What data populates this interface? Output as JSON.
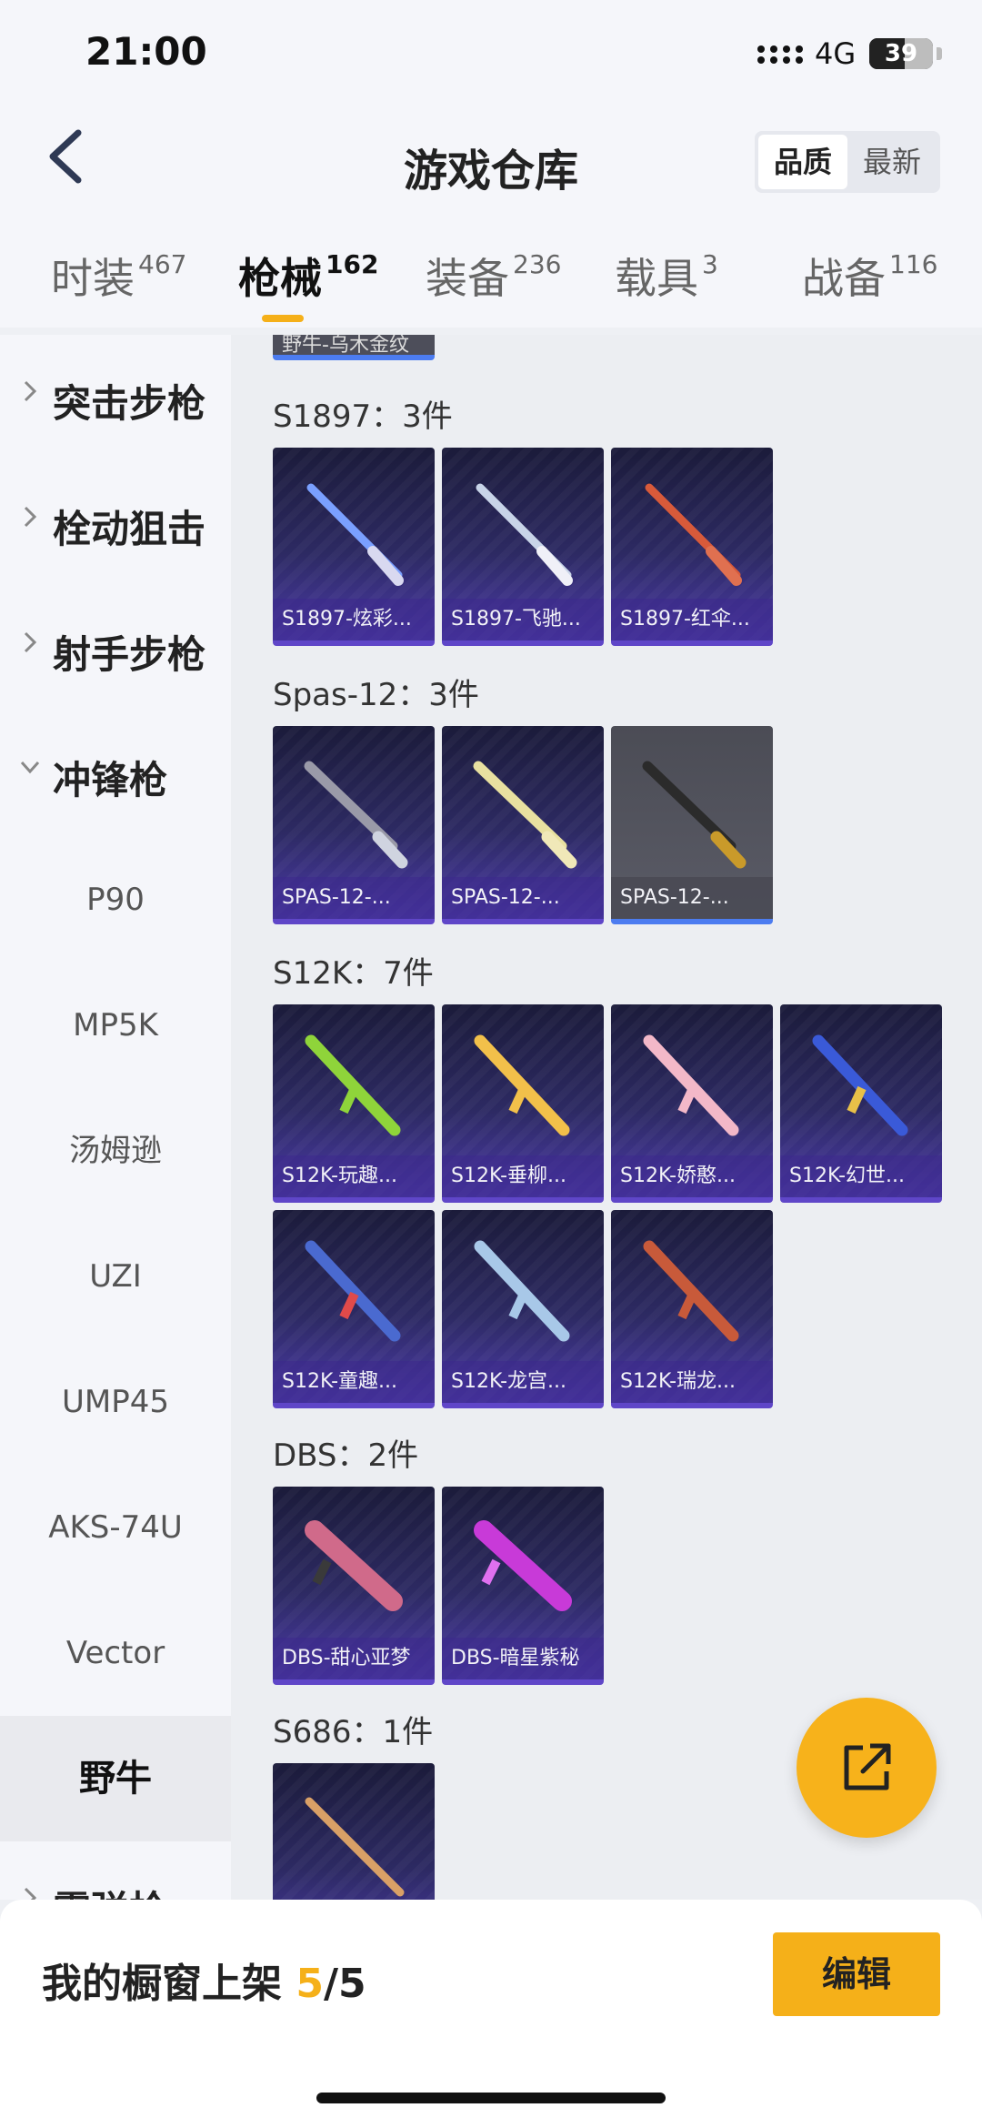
{
  "status": {
    "time": "21:00",
    "network": "4G",
    "battery": "39"
  },
  "header": {
    "title": "游戏仓库",
    "sort_options": [
      "品质",
      "最新"
    ],
    "sort_active": "品质"
  },
  "tabs": [
    {
      "label": "时装",
      "count": "467"
    },
    {
      "label": "枪械",
      "count": "162"
    },
    {
      "label": "装备",
      "count": "236"
    },
    {
      "label": "载具",
      "count": "3"
    },
    {
      "label": "战备",
      "count": "116"
    }
  ],
  "sidebar": {
    "categories": [
      "突击步枪",
      "栓动狙击",
      "射手步枪",
      "冲锋枪"
    ],
    "sub_items": [
      "P90",
      "MP5K",
      "汤姆逊",
      "UZI",
      "UMP45",
      "AKS-74U",
      "Vector",
      "野牛"
    ],
    "partial_category": "霰弹枪"
  },
  "content": {
    "prev_item": "野牛-乌木金纹",
    "groups": [
      {
        "title": "S1897：3件",
        "items": [
          "S1897-炫彩...",
          "S1897-飞驰...",
          "S1897-红伞..."
        ]
      },
      {
        "title": "Spas-12：3件",
        "items": [
          "SPAS-12-...",
          "SPAS-12-...",
          "SPAS-12-..."
        ]
      },
      {
        "title": "S12K：7件",
        "items": [
          "S12K-玩趣...",
          "S12K-垂柳...",
          "S12K-娇憨...",
          "S12K-幻世...",
          "S12K-童趣...",
          "S12K-龙宫...",
          "S12K-瑞龙..."
        ]
      },
      {
        "title": "DBS：2件",
        "items": [
          "DBS-甜心亚梦",
          "DBS-暗星紫秘"
        ]
      },
      {
        "title": "S686：1件",
        "items": [
          ""
        ]
      }
    ]
  },
  "bottom": {
    "showcase_label": "我的橱窗上架 ",
    "showcase_current": "5",
    "showcase_total": "/5",
    "edit_label": "编辑"
  },
  "colors": {
    "accent": "#f5b019",
    "card_purple": "#4b3aa8",
    "card_grey": "#5a5b66"
  }
}
